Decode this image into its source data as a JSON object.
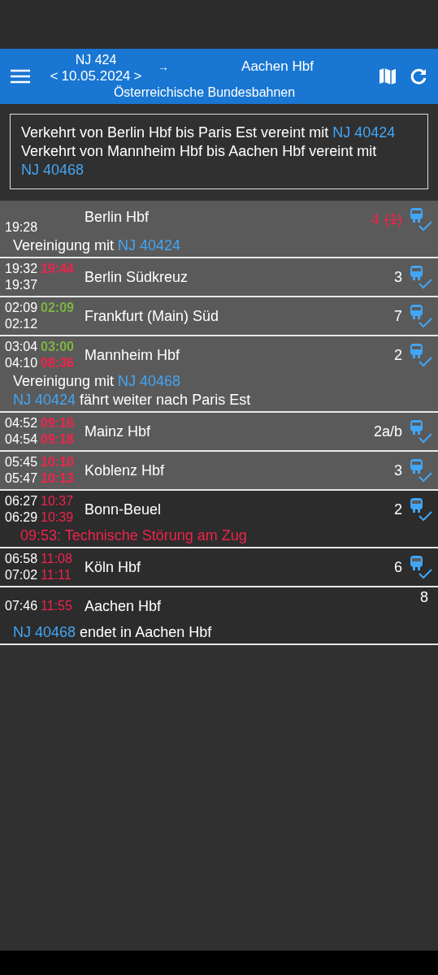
{
  "header": {
    "train": "NJ 424",
    "prev": "<",
    "date": "10.05.2024",
    "next": ">",
    "arrow": "→",
    "destination": "Aachen Hbf",
    "operator": "Österreichische Bundesbahnen"
  },
  "info": [
    [
      {
        "text": "Verkehrt von Berlin Hbf bis Paris Est vereint mit ",
        "link": false
      },
      {
        "text": "NJ 40424",
        "link": true
      }
    ],
    [
      {
        "text": "Verkehrt von Mannheim Hbf bis Aachen Hbf vereint mit ",
        "link": false
      },
      {
        "text": "NJ 40468",
        "link": true
      }
    ]
  ],
  "stops": [
    {
      "passed": true,
      "departure": {
        "planned": "19:28"
      },
      "station": "Berlin Hbf",
      "platform": {
        "text": "4",
        "changed": true,
        "old": "(1)"
      },
      "wagon_order": true,
      "notes": [
        {
          "kind": "info",
          "parts": [
            {
              "text": "Vereinigung mit ",
              "link": false
            },
            {
              "text": "NJ 40424",
              "link": true
            }
          ]
        }
      ]
    },
    {
      "passed": true,
      "arrival": {
        "planned": "19:32",
        "actual": "19:44",
        "color": "#f0234b"
      },
      "departure": {
        "planned": "19:37"
      },
      "station": "Berlin Südkreuz",
      "platform": {
        "text": "3",
        "changed": false
      },
      "wagon_order": true
    },
    {
      "passed": true,
      "arrival": {
        "planned": "02:09",
        "actual": "02:09",
        "color": "#7cb342"
      },
      "departure": {
        "planned": "02:12"
      },
      "station": "Frankfurt (Main) Süd",
      "platform": {
        "text": "7",
        "changed": false
      },
      "wagon_order": true
    },
    {
      "passed": true,
      "arrival": {
        "planned": "03:04",
        "actual": "03:00",
        "color": "#7cb342"
      },
      "departure": {
        "planned": "04:10",
        "actual": "08:36",
        "color": "#f0234b"
      },
      "station": "Mannheim Hbf",
      "platform": {
        "text": "2",
        "changed": false
      },
      "wagon_order": true,
      "notes": [
        {
          "kind": "info",
          "parts": [
            {
              "text": "Vereinigung mit ",
              "link": false
            },
            {
              "text": "NJ 40468",
              "link": true
            }
          ]
        },
        {
          "kind": "info",
          "parts": [
            {
              "text": "NJ 40424",
              "link": true
            },
            {
              "text": " fährt weiter nach Paris Est",
              "link": false
            }
          ]
        }
      ]
    },
    {
      "passed": true,
      "arrival": {
        "planned": "04:52",
        "actual": "09:16",
        "color": "#f0234b"
      },
      "departure": {
        "planned": "04:54",
        "actual": "09:18",
        "color": "#f0234b"
      },
      "station": "Mainz Hbf",
      "platform": {
        "text": "2a/b",
        "changed": false
      },
      "wagon_order": true
    },
    {
      "passed": true,
      "arrival": {
        "planned": "05:45",
        "actual": "10:10",
        "color": "#f0234b"
      },
      "departure": {
        "planned": "05:47",
        "actual": "10:13",
        "color": "#f0234b"
      },
      "station": "Koblenz Hbf",
      "platform": {
        "text": "3",
        "changed": false
      },
      "wagon_order": true
    },
    {
      "passed": false,
      "arrival": {
        "planned": "06:27",
        "actual": "10:37",
        "color": "#f0234b"
      },
      "departure": {
        "planned": "06:29",
        "actual": "10:39",
        "color": "#f0234b"
      },
      "station": "Bonn-Beuel",
      "platform": {
        "text": "2",
        "changed": false
      },
      "wagon_order": true,
      "notes": [
        {
          "kind": "alert",
          "parts": [
            {
              "text": "09:53: Technische Störung am Zug",
              "link": false
            }
          ]
        }
      ]
    },
    {
      "passed": false,
      "arrival": {
        "planned": "06:58",
        "actual": "11:08",
        "color": "#f0234b"
      },
      "departure": {
        "planned": "07:02",
        "actual": "11:11",
        "color": "#f0234b"
      },
      "station": "Köln Hbf",
      "platform": {
        "text": "6",
        "changed": false
      },
      "wagon_order": true
    },
    {
      "passed": false,
      "arrival": {
        "planned": "07:46",
        "actual": "11:55",
        "color": "#f0234b"
      },
      "station": "Aachen Hbf",
      "platform": {
        "text": "8",
        "changed": false
      },
      "wagon_order": false,
      "notes": [
        {
          "kind": "info",
          "parts": [
            {
              "text": "NJ 40468",
              "link": true
            },
            {
              "text": " endet in Aachen Hbf",
              "link": false
            }
          ]
        }
      ]
    }
  ]
}
